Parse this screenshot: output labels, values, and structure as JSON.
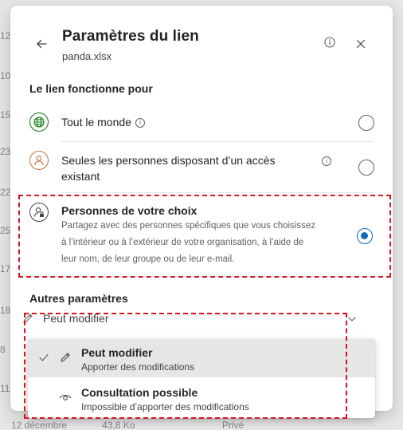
{
  "background": {
    "row_numbers": [
      "12",
      "10",
      "15",
      "23",
      "22",
      "25",
      "17",
      "18",
      "8",
      "11"
    ],
    "bottom_row": {
      "date": "12 décembre",
      "size": "43,8 Ko",
      "access": "Privé"
    }
  },
  "dialog": {
    "title": "Paramètres du lien",
    "subtitle": "panda.xlsx",
    "icons": {
      "back": "arrow-left-icon",
      "info": "info-icon",
      "close": "close-icon"
    }
  },
  "link_works_for": {
    "label": "Le lien fonctionne pour",
    "options": [
      {
        "label": "Tout le monde",
        "icon": "globe-icon",
        "checked": false
      },
      {
        "label": "Seules les personnes disposant d’un accès existant",
        "label_line1": "Seules les personnes disposant d’un accès",
        "label_line2": "existant",
        "icon": "person-icon",
        "checked": false
      },
      {
        "label": "Personnes de votre choix",
        "icon": "person-lock-icon",
        "checked": true,
        "description_line1": "Partagez avec des personnes spécifiques que vous choisissez",
        "description_line2": "à l’intérieur ou à l’extérieur de votre organisation, à l’aide de",
        "description_line3": "leur nom, de leur groupe ou de leur e-mail."
      }
    ]
  },
  "other_settings": {
    "label": "Autres paramètres",
    "permission_value": "Peut modifier",
    "menu": [
      {
        "title": "Peut modifier",
        "desc": "Apporter des modifications",
        "selected": true,
        "icon": "pencil-icon"
      },
      {
        "title": "Consultation possible",
        "desc": "Impossible d’apporter des modifications",
        "selected": false,
        "icon": "eye-icon"
      }
    ]
  },
  "colors": {
    "accent": "#0f6cbd",
    "highlight": "#d8141c"
  }
}
